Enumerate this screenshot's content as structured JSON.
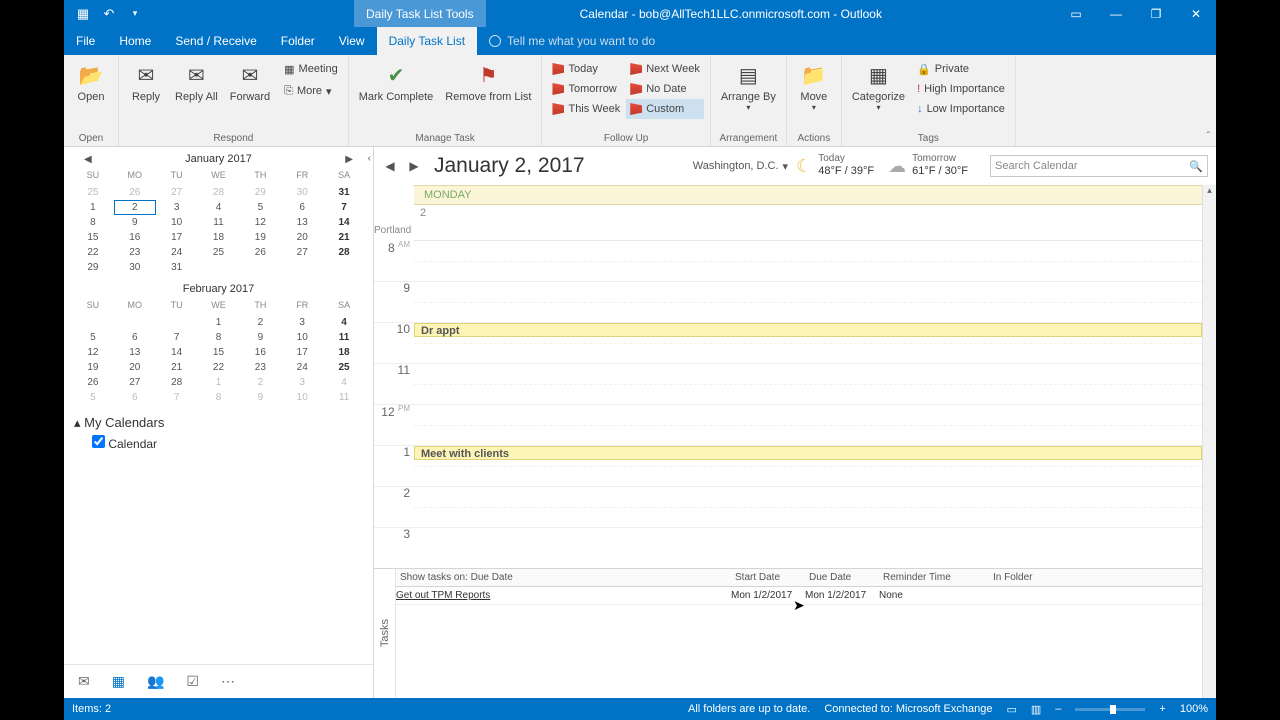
{
  "title_bar": {
    "tool_tab": "Daily Task List Tools",
    "title": "Calendar - bob@AllTech1LLC.onmicrosoft.com  -  Outlook"
  },
  "ribbon_tabs": [
    "File",
    "Home",
    "Send / Receive",
    "Folder",
    "View",
    "Daily Task List"
  ],
  "tellme": "Tell me what you want to do",
  "ribbon": {
    "open": "Open",
    "reply": "Reply",
    "reply_all": "Reply All",
    "forward": "Forward",
    "meeting": "Meeting",
    "more": "More",
    "mark_complete": "Mark Complete",
    "remove_from_list": "Remove from List",
    "today": "Today",
    "tomorrow": "Tomorrow",
    "this_week": "This Week",
    "next_week": "Next Week",
    "no_date": "No Date",
    "custom": "Custom",
    "arrange_by": "Arrange By",
    "move": "Move",
    "categorize": "Categorize",
    "private": "Private",
    "high_importance": "High Importance",
    "low_importance": "Low Importance",
    "groups": {
      "open": "Open",
      "respond": "Respond",
      "manage": "Manage Task",
      "followup": "Follow Up",
      "arrangement": "Arrangement",
      "actions": "Actions",
      "tags": "Tags"
    }
  },
  "minical": {
    "month1": "January 2017",
    "month2": "February 2017",
    "dow": [
      "SU",
      "MO",
      "TU",
      "WE",
      "TH",
      "FR",
      "SA"
    ],
    "m1_cells": [
      {
        "v": "25",
        "d": 1
      },
      {
        "v": "26",
        "d": 1
      },
      {
        "v": "27",
        "d": 1
      },
      {
        "v": "28",
        "d": 1
      },
      {
        "v": "29",
        "d": 1
      },
      {
        "v": "30",
        "d": 1
      },
      {
        "v": "31",
        "b": 1
      },
      {
        "v": "1"
      },
      {
        "v": "2",
        "t": 1
      },
      {
        "v": "3"
      },
      {
        "v": "4"
      },
      {
        "v": "5"
      },
      {
        "v": "6"
      },
      {
        "v": "7",
        "b": 1
      },
      {
        "v": "8"
      },
      {
        "v": "9"
      },
      {
        "v": "10"
      },
      {
        "v": "11"
      },
      {
        "v": "12"
      },
      {
        "v": "13"
      },
      {
        "v": "14",
        "b": 1
      },
      {
        "v": "15"
      },
      {
        "v": "16"
      },
      {
        "v": "17"
      },
      {
        "v": "18"
      },
      {
        "v": "19"
      },
      {
        "v": "20"
      },
      {
        "v": "21",
        "b": 1
      },
      {
        "v": "22"
      },
      {
        "v": "23"
      },
      {
        "v": "24"
      },
      {
        "v": "25"
      },
      {
        "v": "26"
      },
      {
        "v": "27"
      },
      {
        "v": "28",
        "b": 1
      },
      {
        "v": "29"
      },
      {
        "v": "30"
      },
      {
        "v": "31"
      }
    ],
    "m2_cells": [
      {
        "v": ""
      },
      {
        "v": ""
      },
      {
        "v": ""
      },
      {
        "v": "1"
      },
      {
        "v": "2"
      },
      {
        "v": "3"
      },
      {
        "v": "4",
        "b": 1
      },
      {
        "v": "5"
      },
      {
        "v": "6"
      },
      {
        "v": "7"
      },
      {
        "v": "8"
      },
      {
        "v": "9"
      },
      {
        "v": "10"
      },
      {
        "v": "11",
        "b": 1
      },
      {
        "v": "12"
      },
      {
        "v": "13"
      },
      {
        "v": "14"
      },
      {
        "v": "15"
      },
      {
        "v": "16"
      },
      {
        "v": "17"
      },
      {
        "v": "18",
        "b": 1
      },
      {
        "v": "19"
      },
      {
        "v": "20"
      },
      {
        "v": "21"
      },
      {
        "v": "22"
      },
      {
        "v": "23"
      },
      {
        "v": "24"
      },
      {
        "v": "25",
        "b": 1
      },
      {
        "v": "26"
      },
      {
        "v": "27"
      },
      {
        "v": "28"
      },
      {
        "v": "1",
        "d": 1
      },
      {
        "v": "2",
        "d": 1
      },
      {
        "v": "3",
        "d": 1
      },
      {
        "v": "4",
        "d": 1
      },
      {
        "v": "5",
        "d": 1
      },
      {
        "v": "6",
        "d": 1
      },
      {
        "v": "7",
        "d": 1
      },
      {
        "v": "8",
        "d": 1
      },
      {
        "v": "9",
        "d": 1
      },
      {
        "v": "10",
        "d": 1
      },
      {
        "v": "11",
        "d": 1
      }
    ]
  },
  "nav": {
    "my_calendars": "My Calendars",
    "calendar": "Calendar"
  },
  "calendar": {
    "date_title": "January 2, 2017",
    "location": "Washington,  D.C.",
    "today_label": "Today",
    "today_temp": "48°F / 39°F",
    "tomorrow_label": "Tomorrow",
    "tomorrow_temp": "61°F / 30°F",
    "search_placeholder": "Search Calendar",
    "day_header": "MONDAY",
    "day_number": "2",
    "tz": "Portland",
    "hours": [
      "8",
      "9",
      "10",
      "11",
      "12",
      "1",
      "2",
      "3"
    ],
    "am": "AM",
    "pm": "PM",
    "appts": {
      "ten": "Dr appt",
      "one": "Meet with clients"
    }
  },
  "tasks": {
    "gutter": "Tasks",
    "filter": "Show tasks on: Due Date",
    "cols": {
      "start": "Start Date",
      "due": "Due Date",
      "reminder": "Reminder Time",
      "folder": "In Folder"
    },
    "row": {
      "subject": "Get out TPM Reports",
      "start": "Mon 1/2/2017",
      "due": "Mon 1/2/2017",
      "reminder": "None"
    }
  },
  "status": {
    "items": "Items: 2",
    "sync": "All folders are up to date.",
    "conn": "Connected to: Microsoft Exchange",
    "zoom": "100%"
  }
}
